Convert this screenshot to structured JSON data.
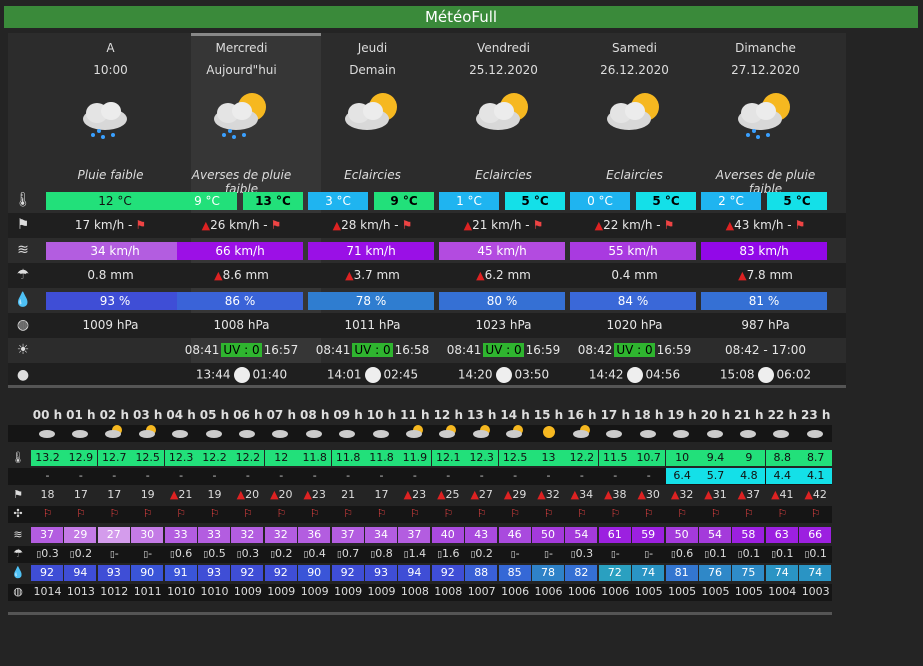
{
  "title": "MétéoFull",
  "days": [
    {
      "name": "A",
      "sub": "10:00",
      "cond": "Pluie faible",
      "icon": "rain",
      "tmin": "12 °C",
      "tmax": "",
      "wind": "17 km/h -",
      "wind_warn": false,
      "gust": "34 km/h",
      "gust_color": "#b35de0",
      "rain": "0.8 mm",
      "rain_warn": false,
      "hum": "93 %",
      "hum_color": "#3f4ed6",
      "press": "1009 hPa",
      "sun": "",
      "moon": ""
    },
    {
      "name": "Mercredi",
      "sub": "Aujourd\"hui",
      "cond": "Averses de pluie faible",
      "icon": "sunrain",
      "tmin": "9 °C",
      "tmax": "13 °C",
      "wind": "26 km/h -",
      "wind_warn": true,
      "gust": "66 km/h",
      "gust_color": "#9c10e6",
      "rain": "8.6 mm",
      "rain_warn": true,
      "hum": "86 %",
      "hum_color": "#3a63d8",
      "press": "1008 hPa",
      "sunrise": "08:41",
      "uv": "UV : 0",
      "sunset": "16:57",
      "moonrise": "13:44",
      "moonset": "01:40"
    },
    {
      "name": "Jeudi",
      "sub": "Demain",
      "cond": "Eclaircies",
      "icon": "sunny-cloud",
      "tmin": "3 °C",
      "tmax": "9 °C",
      "wind": "28 km/h -",
      "wind_warn": true,
      "gust": "71 km/h",
      "gust_color": "#9a10e6",
      "rain": "3.7 mm",
      "rain_warn": true,
      "hum": "78 %",
      "hum_color": "#2f7dd0",
      "press": "1011 hPa",
      "sunrise": "08:41",
      "uv": "UV : 0",
      "sunset": "16:58",
      "moonrise": "14:01",
      "moonset": "02:45"
    },
    {
      "name": "Vendredi",
      "sub": "25.12.2020",
      "cond": "Eclaircies",
      "icon": "sunny-cloud",
      "tmin": "1 °C",
      "tmax": "5 °C",
      "wind": "21 km/h -",
      "wind_warn": true,
      "gust": "45 km/h",
      "gust_color": "#b34be0",
      "rain": "6.2 mm",
      "rain_warn": true,
      "hum": "80 %",
      "hum_color": "#3570d4",
      "press": "1023 hPa",
      "sunrise": "08:41",
      "uv": "UV : 0",
      "sunset": "16:59",
      "moonrise": "14:20",
      "moonset": "03:50"
    },
    {
      "name": "Samedi",
      "sub": "26.12.2020",
      "cond": "Eclaircies",
      "icon": "sunny-cloud",
      "tmin": "0 °C",
      "tmax": "5 °C",
      "wind": "22 km/h -",
      "wind_warn": true,
      "gust": "55 km/h",
      "gust_color": "#a93ae0",
      "rain": "0.4 mm",
      "rain_warn": false,
      "hum": "84 %",
      "hum_color": "#3a68d8",
      "press": "1020 hPa",
      "sunrise": "08:42",
      "uv": "UV : 0",
      "sunset": "16:59",
      "moonrise": "14:42",
      "moonset": "04:56"
    },
    {
      "name": "Dimanche",
      "sub": "27.12.2020",
      "cond": "Averses de pluie faible",
      "icon": "sunrain",
      "tmin": "2 °C",
      "tmax": "5 °C",
      "wind": "43 km/h -",
      "wind_warn": true,
      "gust": "83 km/h",
      "gust_color": "#9208e8",
      "rain": "7.8 mm",
      "rain_warn": true,
      "hum": "81 %",
      "hum_color": "#3570d4",
      "press": "987 hPa",
      "sun_span": "08:42 - 17:00",
      "moonrise": "15:08",
      "moonset": "06:02"
    }
  ],
  "hours": [
    "00 h",
    "01 h",
    "02 h",
    "03 h",
    "04 h",
    "05 h",
    "06 h",
    "07 h",
    "08 h",
    "09 h",
    "10 h",
    "11 h",
    "12 h",
    "13 h",
    "14 h",
    "15 h",
    "16 h",
    "17 h",
    "18 h",
    "19 h",
    "20 h",
    "21 h",
    "22 h",
    "23 h"
  ],
  "temp": [
    "13.2",
    "12.9",
    "12.7",
    "12.5",
    "12.3",
    "12.2",
    "12.2",
    "12",
    "11.8",
    "11.8",
    "11.8",
    "11.9",
    "12.1",
    "12.3",
    "12.5",
    "13",
    "12.2",
    "11.5",
    "10.7",
    "10",
    "9.4",
    "9",
    "8.8",
    "8.7"
  ],
  "temp2": [
    "-",
    "-",
    "-",
    "-",
    "-",
    "-",
    "-",
    "-",
    "-",
    "-",
    "-",
    "-",
    "-",
    "-",
    "-",
    "-",
    "-",
    "-",
    "-",
    "6.4",
    "5.7",
    "4.8",
    "4.4",
    "4.1"
  ],
  "wind": [
    "18",
    "17",
    "17",
    "19",
    "21",
    "19",
    "20",
    "20",
    "23",
    "21",
    "17",
    "23",
    "25",
    "27",
    "29",
    "32",
    "34",
    "38",
    "30",
    "32",
    "31",
    "37",
    "41",
    "42"
  ],
  "wind_warn": [
    false,
    false,
    false,
    false,
    true,
    false,
    true,
    true,
    true,
    false,
    false,
    true,
    true,
    true,
    true,
    true,
    true,
    true,
    true,
    true,
    true,
    true,
    true,
    true
  ],
  "gust": [
    "37",
    "29",
    "27",
    "30",
    "33",
    "33",
    "32",
    "32",
    "36",
    "37",
    "34",
    "37",
    "40",
    "43",
    "46",
    "50",
    "54",
    "61",
    "59",
    "50",
    "54",
    "58",
    "63",
    "66"
  ],
  "gust_colors": [
    "#b35de0",
    "#c47be6",
    "#d49cec",
    "#c47be6",
    "#b35de0",
    "#b35de0",
    "#b35de0",
    "#b35de0",
    "#b35de0",
    "#b35de0",
    "#b35de0",
    "#b35de0",
    "#a94ade",
    "#a94ade",
    "#a94ade",
    "#a43adb",
    "#a43adb",
    "#9c20e0",
    "#9c20e0",
    "#a43adb",
    "#a43adb",
    "#9c20e0",
    "#9c20e0",
    "#9c20e0"
  ],
  "rain": [
    "0.3",
    "0.2",
    "-",
    "-",
    "0.6",
    "0.5",
    "0.3",
    "0.2",
    "0.4",
    "0.7",
    "0.8",
    "1.4",
    "1.6",
    "0.2",
    "-",
    "-",
    "0.3",
    "-",
    "-",
    "0.6",
    "0.1",
    "0.1",
    "0.1",
    "0.1"
  ],
  "hum": [
    "92",
    "94",
    "93",
    "90",
    "91",
    "93",
    "92",
    "92",
    "90",
    "92",
    "93",
    "94",
    "92",
    "88",
    "85",
    "78",
    "82",
    "72",
    "74",
    "81",
    "76",
    "75",
    "74",
    "74"
  ],
  "hum_colors": [
    "#3f4ed6",
    "#3f4ed6",
    "#3f4ed6",
    "#3a55d8",
    "#3a55d8",
    "#3f4ed6",
    "#3f4ed6",
    "#3f4ed6",
    "#3a55d8",
    "#3f4ed6",
    "#3f4ed6",
    "#3f4ed6",
    "#3f4ed6",
    "#3a60d6",
    "#3568d6",
    "#2f82c8",
    "#3570d4",
    "#2aa0c0",
    "#2a94c4",
    "#3376d0",
    "#2f88c8",
    "#2f8cc8",
    "#2a94c4",
    "#2a94c4"
  ],
  "press": [
    "1014",
    "1013",
    "1012",
    "1011",
    "1010",
    "1010",
    "1009",
    "1009",
    "1009",
    "1009",
    "1009",
    "1008",
    "1008",
    "1007",
    "1006",
    "1006",
    "1006",
    "1006",
    "1005",
    "1005",
    "1005",
    "1005",
    "1004",
    "1003"
  ],
  "hicons": [
    "cloud",
    "cloud",
    "sun",
    "sun",
    "cloud",
    "cloud",
    "cloud",
    "cloud",
    "cloud",
    "cloud",
    "cloud",
    "sun",
    "sun",
    "sun",
    "sun",
    "sunonly",
    "sun",
    "cloud",
    "cloud",
    "cloud",
    "cloud",
    "cloud",
    "cloud",
    "cloud"
  ],
  "colors": {
    "temp_bar": "#22e07a",
    "temp_cold": "#1fb4f0",
    "temp_cyan": "#14e0e8",
    "title_bg": "#3a8a3a"
  }
}
